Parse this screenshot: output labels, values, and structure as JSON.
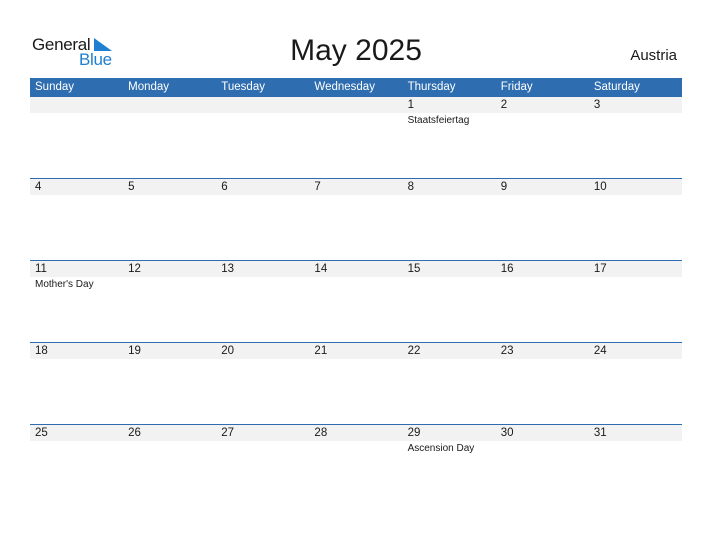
{
  "header": {
    "logo_word1": "General",
    "logo_word2": "Blue",
    "title": "May 2025",
    "country": "Austria"
  },
  "colors": {
    "accent": "#2e6db0",
    "logo_blue": "#1f7fd0",
    "date_band": "#f2f2f2"
  },
  "weekdays": [
    "Sunday",
    "Monday",
    "Tuesday",
    "Wednesday",
    "Thursday",
    "Friday",
    "Saturday"
  ],
  "weeks": [
    [
      {
        "day": "",
        "holiday": ""
      },
      {
        "day": "",
        "holiday": ""
      },
      {
        "day": "",
        "holiday": ""
      },
      {
        "day": "",
        "holiday": ""
      },
      {
        "day": "1",
        "holiday": "Staatsfeiertag"
      },
      {
        "day": "2",
        "holiday": ""
      },
      {
        "day": "3",
        "holiday": ""
      }
    ],
    [
      {
        "day": "4",
        "holiday": ""
      },
      {
        "day": "5",
        "holiday": ""
      },
      {
        "day": "6",
        "holiday": ""
      },
      {
        "day": "7",
        "holiday": ""
      },
      {
        "day": "8",
        "holiday": ""
      },
      {
        "day": "9",
        "holiday": ""
      },
      {
        "day": "10",
        "holiday": ""
      }
    ],
    [
      {
        "day": "11",
        "holiday": "Mother's Day"
      },
      {
        "day": "12",
        "holiday": ""
      },
      {
        "day": "13",
        "holiday": ""
      },
      {
        "day": "14",
        "holiday": ""
      },
      {
        "day": "15",
        "holiday": ""
      },
      {
        "day": "16",
        "holiday": ""
      },
      {
        "day": "17",
        "holiday": ""
      }
    ],
    [
      {
        "day": "18",
        "holiday": ""
      },
      {
        "day": "19",
        "holiday": ""
      },
      {
        "day": "20",
        "holiday": ""
      },
      {
        "day": "21",
        "holiday": ""
      },
      {
        "day": "22",
        "holiday": ""
      },
      {
        "day": "23",
        "holiday": ""
      },
      {
        "day": "24",
        "holiday": ""
      }
    ],
    [
      {
        "day": "25",
        "holiday": ""
      },
      {
        "day": "26",
        "holiday": ""
      },
      {
        "day": "27",
        "holiday": ""
      },
      {
        "day": "28",
        "holiday": ""
      },
      {
        "day": "29",
        "holiday": "Ascension Day"
      },
      {
        "day": "30",
        "holiday": ""
      },
      {
        "day": "31",
        "holiday": ""
      }
    ]
  ]
}
